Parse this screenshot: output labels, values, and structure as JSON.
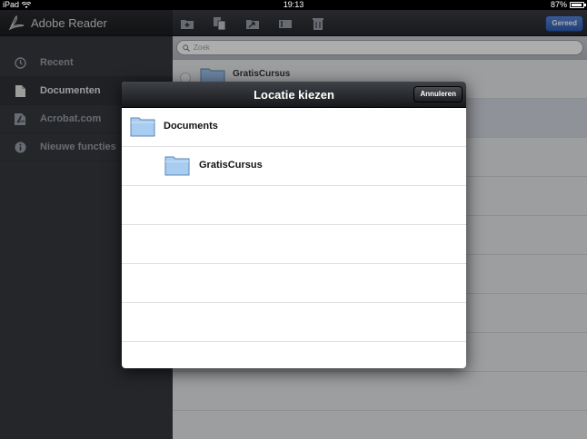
{
  "status_bar": {
    "device": "iPad",
    "time": "19:13",
    "battery": "87%"
  },
  "sidebar": {
    "app_title": "Adobe Reader",
    "items": [
      {
        "label": "Recent",
        "icon": "clock-icon"
      },
      {
        "label": "Documenten",
        "icon": "document-icon",
        "active": true
      },
      {
        "label": "Acrobat.com",
        "icon": "acrobat-icon"
      },
      {
        "label": "Nieuwe functies",
        "icon": "info-icon"
      }
    ]
  },
  "toolbar": {
    "icons": [
      "new-folder-icon",
      "copy-icon",
      "move-icon",
      "rename-icon",
      "trash-icon"
    ],
    "done_label": "Gereed"
  },
  "search": {
    "placeholder": "Zoek"
  },
  "list": {
    "first_row_label": "GratisCursus"
  },
  "modal": {
    "title": "Locatie kiezen",
    "cancel_label": "Annuleren",
    "rows": [
      {
        "label": "Documents",
        "indent": 0
      },
      {
        "label": "GratisCursus",
        "indent": 1
      }
    ]
  },
  "colors": {
    "accent_button": "#2e5eb6",
    "sidebar_bg": "#36393e",
    "folder_blue": "#9cc3ec"
  }
}
